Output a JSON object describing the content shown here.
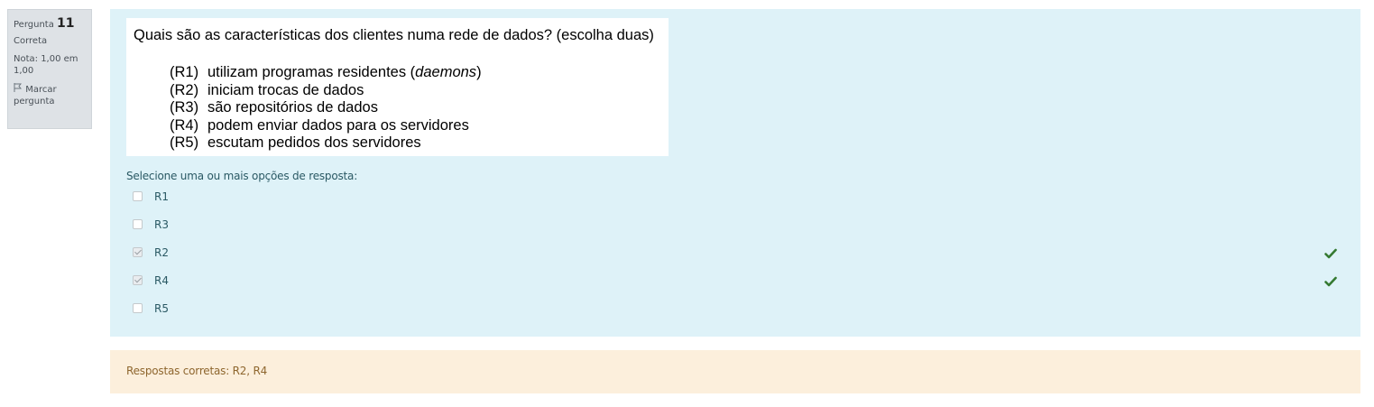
{
  "info": {
    "question_word": "Pergunta",
    "question_number": "11",
    "state": "Correta",
    "grade": "Nota: 1,00 em 1,00",
    "flag_label": "Marcar pergunta"
  },
  "question": {
    "title": "Quais são as características dos clientes numa rede de dados? (escolha duas)",
    "options": [
      {
        "code": "(R1)",
        "text": "utilizam programas residentes (",
        "emph": "daemons",
        "after": ")"
      },
      {
        "code": "(R2)",
        "text": "iniciam trocas de dados",
        "emph": "",
        "after": ""
      },
      {
        "code": "(R3)",
        "text": "são repositórios de dados",
        "emph": "",
        "after": ""
      },
      {
        "code": "(R4)",
        "text": "podem enviar dados para os servidores",
        "emph": "",
        "after": ""
      },
      {
        "code": "(R5)",
        "text": "escutam pedidos dos servidores",
        "emph": "",
        "after": ""
      }
    ]
  },
  "prompt": "Selecione uma ou mais opções de resposta:",
  "answers": [
    {
      "label": "R1",
      "checked": false,
      "correct": false
    },
    {
      "label": "R3",
      "checked": false,
      "correct": false
    },
    {
      "label": "R2",
      "checked": true,
      "correct": true
    },
    {
      "label": "R4",
      "checked": true,
      "correct": true
    },
    {
      "label": "R5",
      "checked": false,
      "correct": false
    }
  ],
  "feedback": "Respostas corretas: R2, R4",
  "colors": {
    "correct_tick": "#357a32"
  }
}
